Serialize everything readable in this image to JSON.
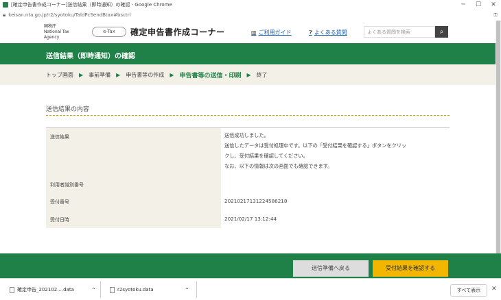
{
  "window": {
    "title": "[確定申告書作成コーナー]送信結果（即時通知）の確認 - Google Chrome",
    "minimize": "─",
    "url": "keisan.nta.go.jp/r2/syotoku/TaldPcSendBtax#bsctrl"
  },
  "header": {
    "agency_line1": "国税庁",
    "agency_line2": "National Tax Agency",
    "logo_text": "e-Tax",
    "site_title": "確定申告書作成コーナー",
    "guide_link": "ご利用ガイド",
    "faq_link": "よくある質問",
    "search_placeholder": "よくある質問を検索"
  },
  "page": {
    "heading": "送信結果（即時通知）の確認"
  },
  "breadcrumb": {
    "items": [
      "トップ画面",
      "事前準備",
      "申告書等の作成",
      "申告書等の送信・印刷",
      "終了"
    ],
    "separator": "▶"
  },
  "result": {
    "section_title": "送信結果の内容",
    "rows": [
      {
        "label": "送信結果",
        "lines": [
          "送信成功しました。",
          "送信したデータは受付処理中です。以下の「受付結果を確認する」ボタンをクリッ",
          "クし、受付結果を確認してください。",
          "なお、以下の情報は次の画面でも確認できます。"
        ]
      },
      {
        "label": "利用者識別番号",
        "value": ""
      },
      {
        "label": "受付番号",
        "value": "20210217131224586218"
      },
      {
        "label": "受付日時",
        "value": "2021/02/17 13:12:44"
      }
    ]
  },
  "footer": {
    "back_button": "送信準備へ戻る",
    "confirm_button": "受付結果を確認する"
  },
  "downloads": {
    "items": [
      {
        "name": "確定申告_202102....data"
      },
      {
        "name": "r2syotoku.data"
      }
    ],
    "show_all": "すべて表示"
  },
  "colors": {
    "brand_green": "#1f8048",
    "accent_yellow": "#f2b600",
    "breadcrumb_bg": "#f3f1e7"
  }
}
